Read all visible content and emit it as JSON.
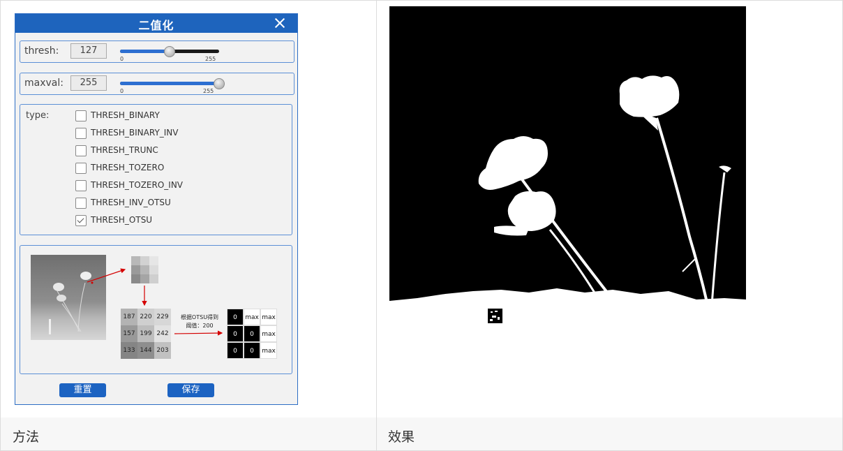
{
  "dialog": {
    "title": "二值化",
    "thresh": {
      "label": "thresh:",
      "value": "127",
      "min_label": "0",
      "max_label": "255",
      "level": 127,
      "max": 255
    },
    "maxval": {
      "label": "maxval:",
      "value": "255",
      "min_label": "0",
      "max_label": "255",
      "level": 255,
      "max": 255
    },
    "type_label": "type:",
    "types": [
      {
        "label": "THRESH_BINARY",
        "checked": false
      },
      {
        "label": "THRESH_BINARY_INV",
        "checked": false
      },
      {
        "label": "THRESH_TRUNC",
        "checked": false
      },
      {
        "label": "THRESH_TOZERO",
        "checked": false
      },
      {
        "label": "THRESH_TOZERO_INV",
        "checked": false
      },
      {
        "label": "THRESH_INV_OTSU",
        "checked": false
      },
      {
        "label": "THRESH_OTSU",
        "checked": true
      }
    ],
    "illustration": {
      "pixel_values": [
        [
          "187",
          "220",
          "229"
        ],
        [
          "157",
          "199",
          "242"
        ],
        [
          "133",
          "144",
          "203"
        ]
      ],
      "note_line1": "根据OTSU得到",
      "note_line2": "阈值：200",
      "result": [
        [
          "0",
          "max",
          "max"
        ],
        [
          "0",
          "0",
          "max"
        ],
        [
          "0",
          "0",
          "max"
        ]
      ]
    },
    "reset_label": "重置",
    "save_label": "保存"
  },
  "table": {
    "col1_footer": "方法",
    "col2_footer": "效果"
  },
  "colors": {
    "accent": "#1e64bd",
    "border": "#5b8fd6",
    "panel": "#f2f2f2"
  }
}
